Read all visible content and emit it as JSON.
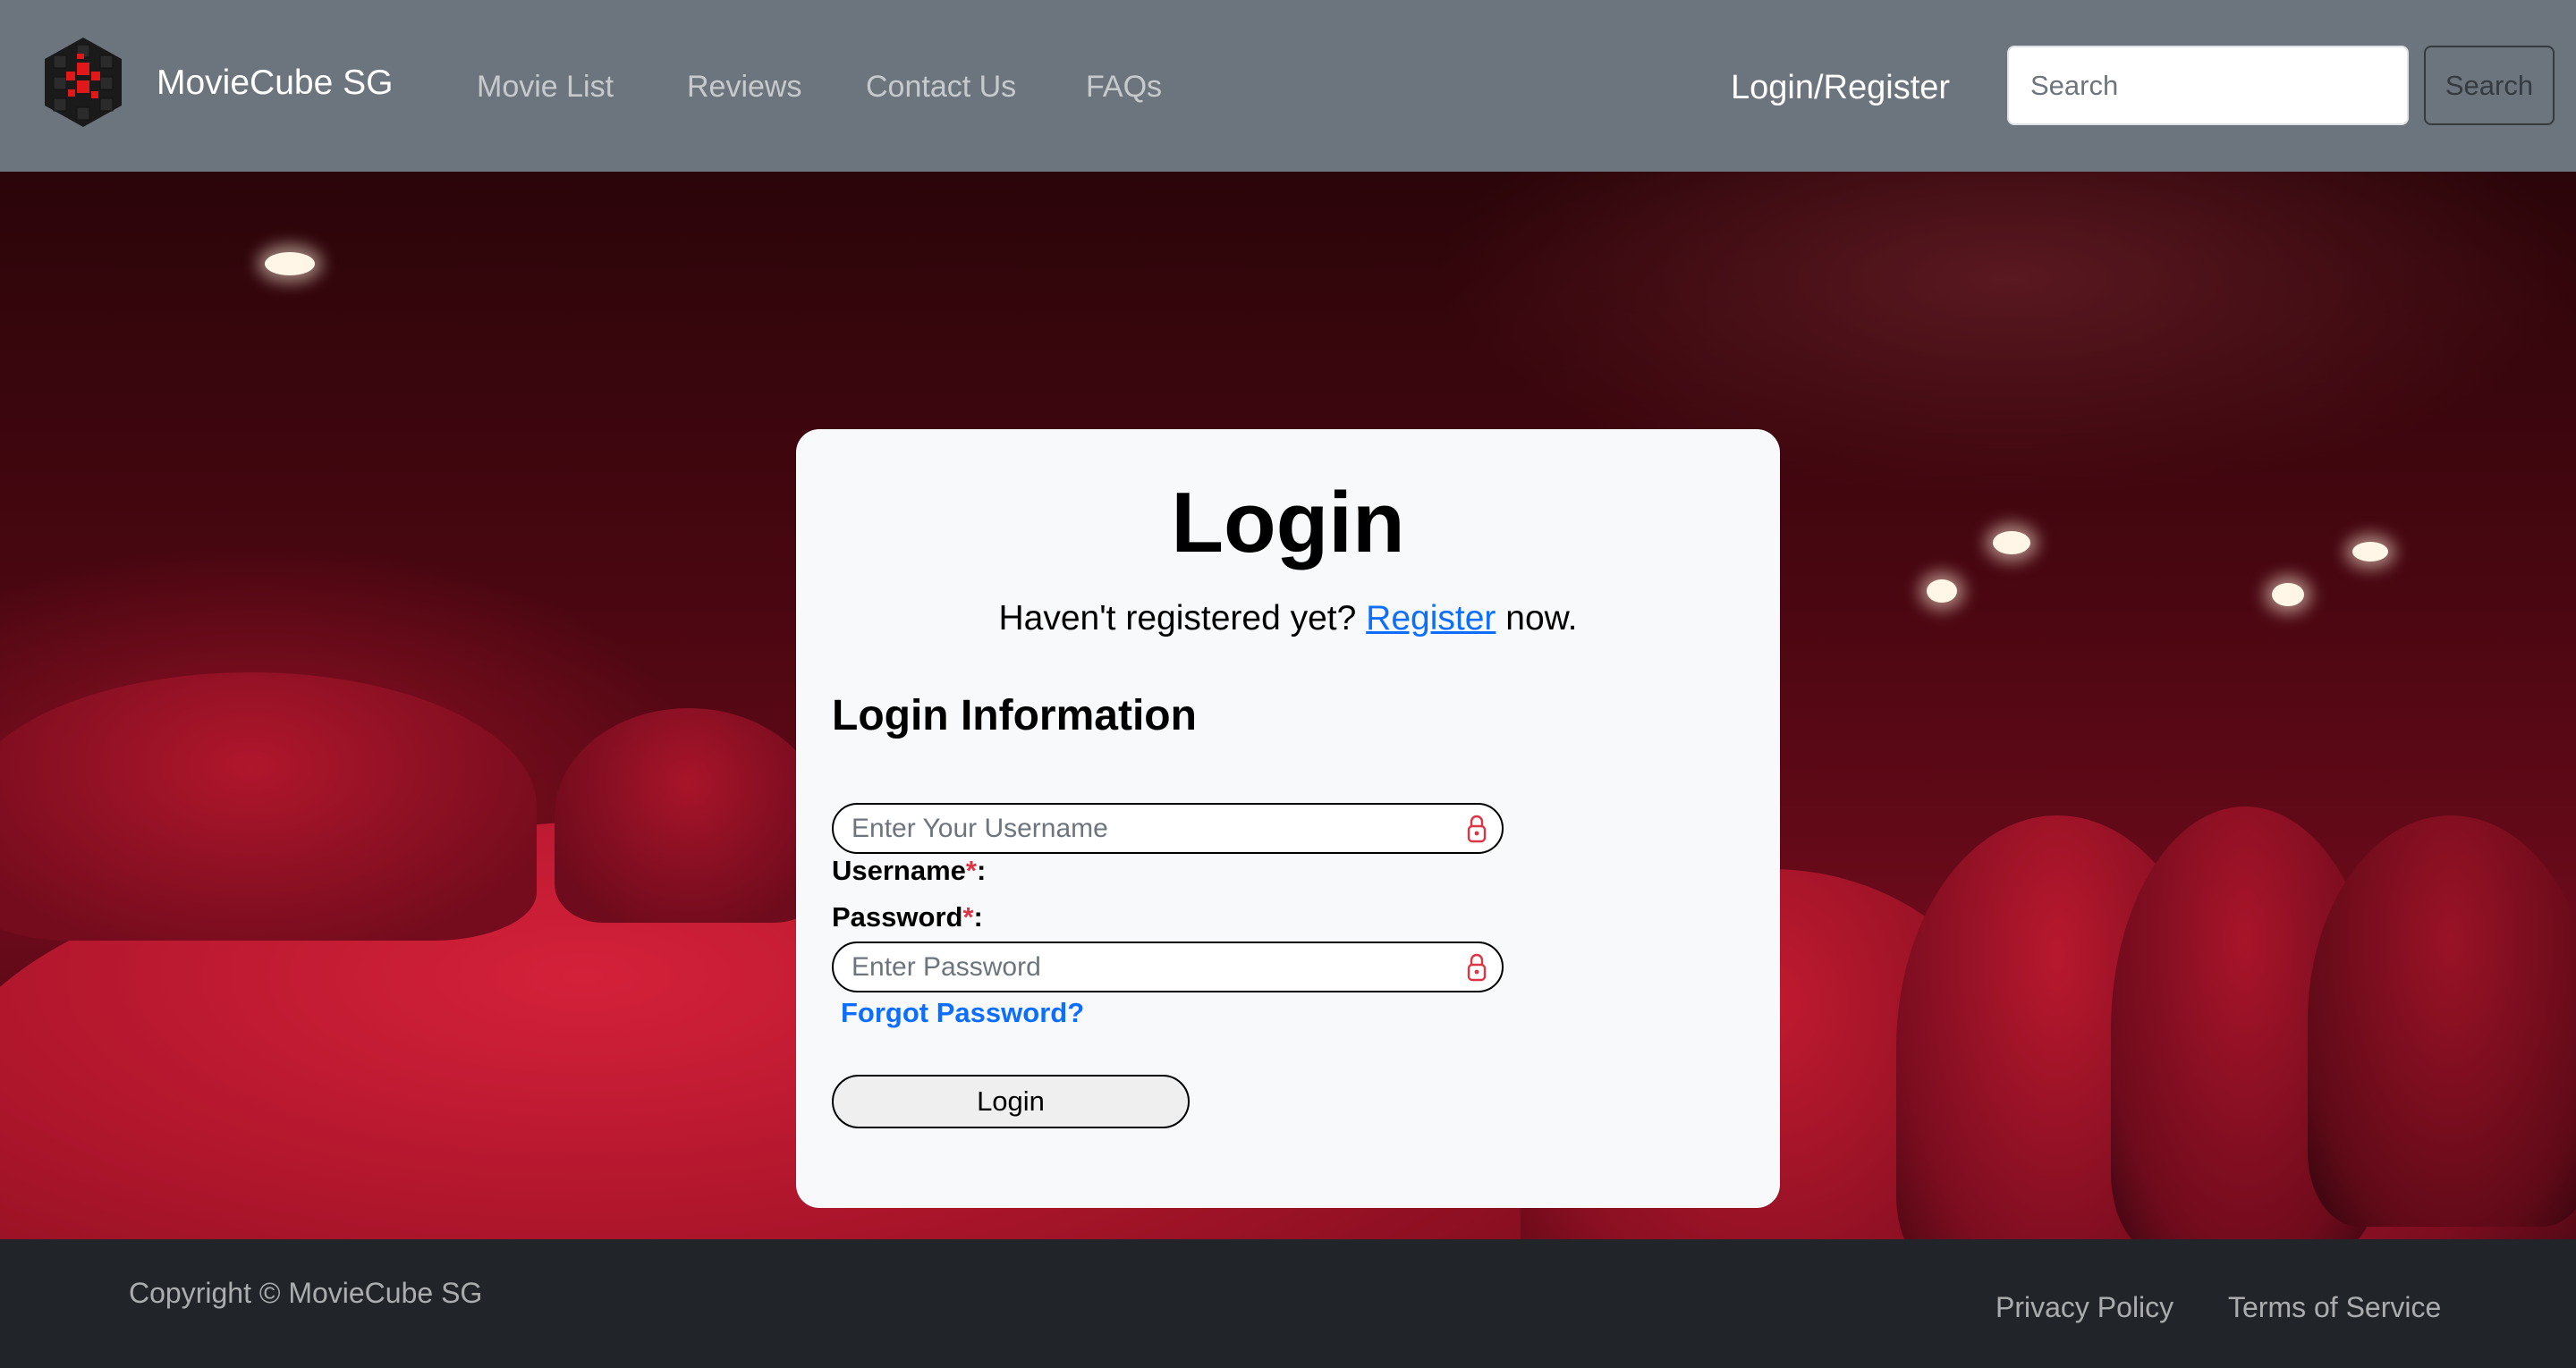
{
  "navbar": {
    "brand": "MovieCube SG",
    "links": [
      "Movie List",
      "Reviews",
      "Contact Us",
      "FAQs"
    ],
    "login_register": "Login/Register",
    "search_placeholder": "Search",
    "search_button": "Search"
  },
  "login_card": {
    "title": "Login",
    "subtitle_prefix": "Haven't registered yet?",
    "register_link": "Register",
    "subtitle_suffix": "now.",
    "section_heading": "Login Information",
    "username_label": "Username",
    "password_label": "Password",
    "required_mark": "*",
    "label_colon": ":",
    "username_placeholder": "Enter Your Username",
    "password_placeholder": "Enter Password",
    "forgot_password": "Forgot Password?",
    "login_button": "Login"
  },
  "footer": {
    "copyright": "Copyright © MovieCube SG",
    "links": [
      "Privacy Policy",
      "Terms of Service"
    ]
  },
  "colors": {
    "navbar_bg": "#6c757d",
    "footer_bg": "#212529",
    "link_blue": "#0d6efd",
    "required_red": "#dc3545",
    "card_bg": "#f8f9fa"
  },
  "icons": {
    "brand": "cube-logo-icon",
    "field": "lock-icon"
  }
}
